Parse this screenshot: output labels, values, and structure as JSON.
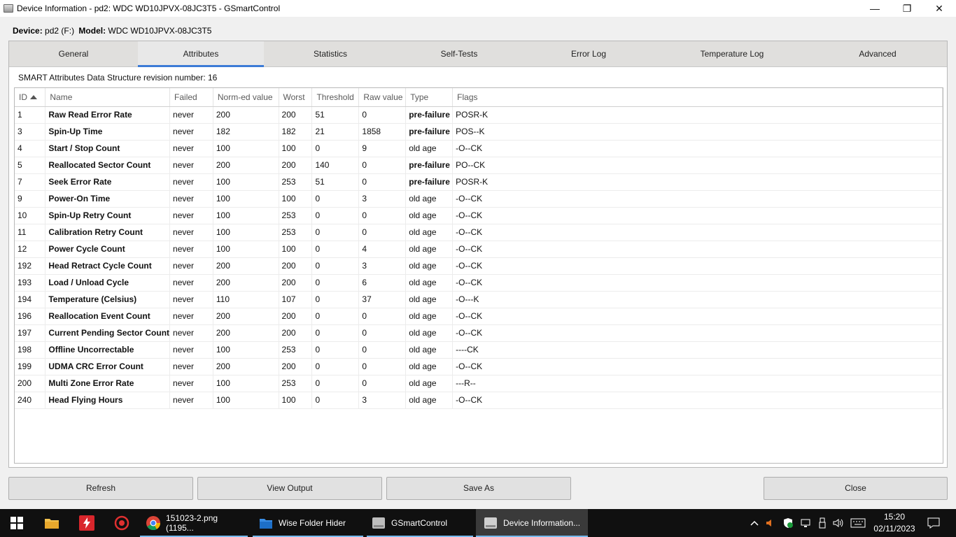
{
  "window": {
    "title": "Device Information - pd2: WDC WD10JPVX-08JC3T5 - GSmartControl",
    "minimize_glyph": "—",
    "maximize_glyph": "❐",
    "close_glyph": "✕"
  },
  "device": {
    "device_label": "Device:",
    "device_value": "pd2 (F:)",
    "model_label": "Model:",
    "model_value": "WDC WD10JPVX-08JC3T5"
  },
  "tabs": [
    {
      "label": "General"
    },
    {
      "label": "Attributes"
    },
    {
      "label": "Statistics"
    },
    {
      "label": "Self-Tests"
    },
    {
      "label": "Error Log"
    },
    {
      "label": "Temperature Log"
    },
    {
      "label": "Advanced"
    }
  ],
  "active_tab": "Attributes",
  "revision_text": "SMART Attributes Data Structure revision number: 16",
  "table": {
    "columns": [
      "ID",
      "Name",
      "Failed",
      "Norm-ed value",
      "Worst",
      "Threshold",
      "Raw value",
      "Type",
      "Flags"
    ],
    "sorted_column": "ID",
    "rows": [
      {
        "id": "1",
        "name": "Raw Read Error Rate",
        "failed": "never",
        "norm": "200",
        "worst": "200",
        "threshold": "51",
        "raw": "0",
        "type": "pre-failure",
        "flags": "POSR-K"
      },
      {
        "id": "3",
        "name": "Spin-Up Time",
        "failed": "never",
        "norm": "182",
        "worst": "182",
        "threshold": "21",
        "raw": "1858",
        "type": "pre-failure",
        "flags": "POS--K"
      },
      {
        "id": "4",
        "name": "Start / Stop Count",
        "failed": "never",
        "norm": "100",
        "worst": "100",
        "threshold": "0",
        "raw": "9",
        "type": "old age",
        "flags": "-O--CK"
      },
      {
        "id": "5",
        "name": "Reallocated Sector Count",
        "failed": "never",
        "norm": "200",
        "worst": "200",
        "threshold": "140",
        "raw": "0",
        "type": "pre-failure",
        "flags": "PO--CK"
      },
      {
        "id": "7",
        "name": "Seek Error Rate",
        "failed": "never",
        "norm": "100",
        "worst": "253",
        "threshold": "51",
        "raw": "0",
        "type": "pre-failure",
        "flags": "POSR-K"
      },
      {
        "id": "9",
        "name": "Power-On Time",
        "failed": "never",
        "norm": "100",
        "worst": "100",
        "threshold": "0",
        "raw": "3",
        "type": "old age",
        "flags": "-O--CK"
      },
      {
        "id": "10",
        "name": "Spin-Up Retry Count",
        "failed": "never",
        "norm": "100",
        "worst": "253",
        "threshold": "0",
        "raw": "0",
        "type": "old age",
        "flags": "-O--CK"
      },
      {
        "id": "11",
        "name": "Calibration Retry Count",
        "failed": "never",
        "norm": "100",
        "worst": "253",
        "threshold": "0",
        "raw": "0",
        "type": "old age",
        "flags": "-O--CK"
      },
      {
        "id": "12",
        "name": "Power Cycle Count",
        "failed": "never",
        "norm": "100",
        "worst": "100",
        "threshold": "0",
        "raw": "4",
        "type": "old age",
        "flags": "-O--CK"
      },
      {
        "id": "192",
        "name": "Head Retract Cycle Count",
        "failed": "never",
        "norm": "200",
        "worst": "200",
        "threshold": "0",
        "raw": "3",
        "type": "old age",
        "flags": "-O--CK"
      },
      {
        "id": "193",
        "name": "Load / Unload Cycle",
        "failed": "never",
        "norm": "200",
        "worst": "200",
        "threshold": "0",
        "raw": "6",
        "type": "old age",
        "flags": "-O--CK"
      },
      {
        "id": "194",
        "name": "Temperature (Celsius)",
        "failed": "never",
        "norm": "110",
        "worst": "107",
        "threshold": "0",
        "raw": "37",
        "type": "old age",
        "flags": "-O---K"
      },
      {
        "id": "196",
        "name": "Reallocation Event Count",
        "failed": "never",
        "norm": "200",
        "worst": "200",
        "threshold": "0",
        "raw": "0",
        "type": "old age",
        "flags": "-O--CK"
      },
      {
        "id": "197",
        "name": "Current Pending Sector Count",
        "failed": "never",
        "norm": "200",
        "worst": "200",
        "threshold": "0",
        "raw": "0",
        "type": "old age",
        "flags": "-O--CK"
      },
      {
        "id": "198",
        "name": "Offline Uncorrectable",
        "failed": "never",
        "norm": "100",
        "worst": "253",
        "threshold": "0",
        "raw": "0",
        "type": "old age",
        "flags": "----CK"
      },
      {
        "id": "199",
        "name": "UDMA CRC Error Count",
        "failed": "never",
        "norm": "200",
        "worst": "200",
        "threshold": "0",
        "raw": "0",
        "type": "old age",
        "flags": "-O--CK"
      },
      {
        "id": "200",
        "name": "Multi Zone Error Rate",
        "failed": "never",
        "norm": "100",
        "worst": "253",
        "threshold": "0",
        "raw": "0",
        "type": "old age",
        "flags": "---R--"
      },
      {
        "id": "240",
        "name": "Head Flying Hours",
        "failed": "never",
        "norm": "100",
        "worst": "100",
        "threshold": "0",
        "raw": "3",
        "type": "old age",
        "flags": "-O--CK"
      }
    ]
  },
  "buttons": {
    "refresh": "Refresh",
    "view_output": "View Output",
    "save_as": "Save As",
    "close": "Close"
  },
  "taskbar": {
    "items": [
      {
        "label": "151023-2.png (1195...",
        "icon": "chrome-icon"
      },
      {
        "label": "Wise Folder Hider",
        "icon": "folder-hider-icon"
      },
      {
        "label": "GSmartControl",
        "icon": "drive-icon"
      },
      {
        "label": "Device Information...",
        "icon": "drive-icon",
        "active": true
      }
    ],
    "time": "15:20",
    "date": "02/11/2023",
    "accent_color": "#76b9ed"
  }
}
